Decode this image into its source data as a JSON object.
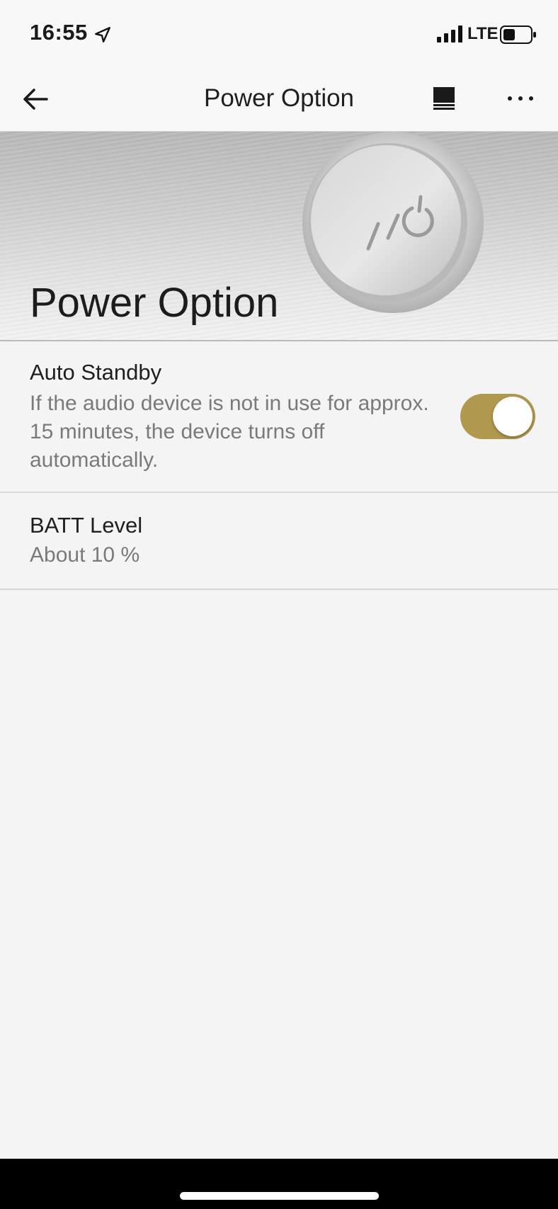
{
  "status_bar": {
    "time": "16:55",
    "network": "LTE",
    "icons": [
      "location-arrow-icon",
      "signal-bars-icon",
      "battery-icon"
    ]
  },
  "nav": {
    "title": "Power Option",
    "icons": [
      "back-arrow-icon",
      "list-view-icon",
      "more-dots-icon"
    ]
  },
  "hero": {
    "title": "Power Option",
    "image": "power-button-icon"
  },
  "settings": {
    "auto_standby": {
      "title": "Auto Standby",
      "description": "If the audio device is not in use for approx. 15 minutes, the device turns off automatically.",
      "enabled": true
    },
    "batt_level": {
      "title": "BATT Level",
      "value": "About 10 %"
    }
  },
  "colors": {
    "toggle_on": "#b0984f",
    "background": "#f4f4f4"
  }
}
